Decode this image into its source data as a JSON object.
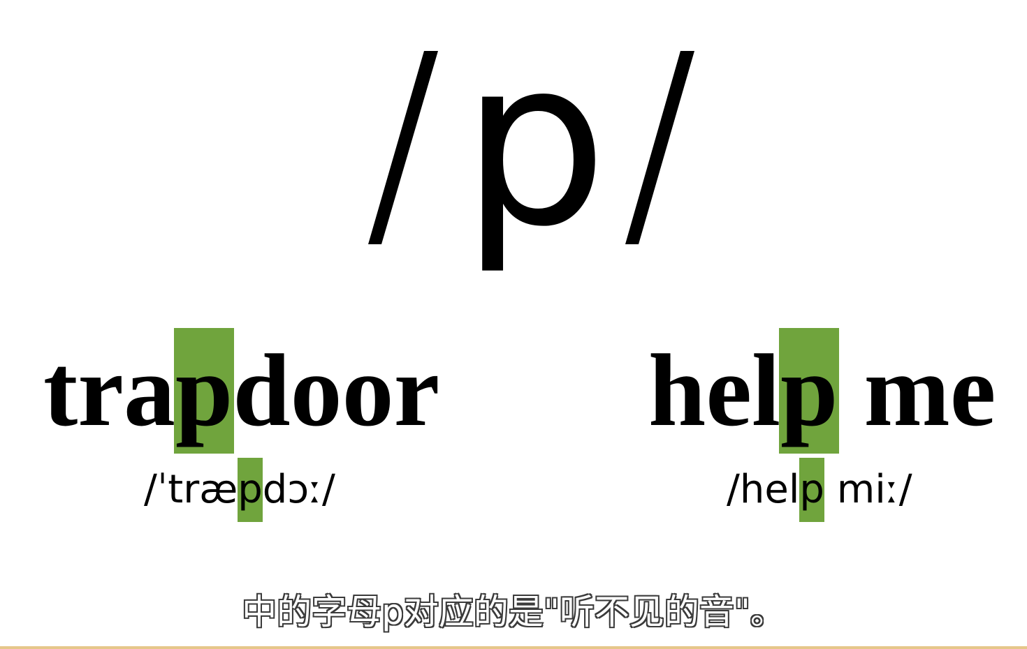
{
  "phoneme": {
    "slash_left": "/",
    "letter": "p",
    "slash_right": "/"
  },
  "examples": [
    {
      "word_before": "tra",
      "word_highlight": "p",
      "word_after": "door",
      "ipa_before": "/ˈtræ",
      "ipa_highlight": "p",
      "ipa_after": "dɔː/"
    },
    {
      "word_before": "hel",
      "word_highlight": "p",
      "word_after": " me",
      "ipa_before": "/hel",
      "ipa_highlight": "p",
      "ipa_after": " miː/"
    }
  ],
  "subtitle": "中的字母p对应的是\"听不见的音\"。",
  "colors": {
    "highlight": "#70a43d",
    "text": "#000000",
    "background": "#ffffff"
  }
}
